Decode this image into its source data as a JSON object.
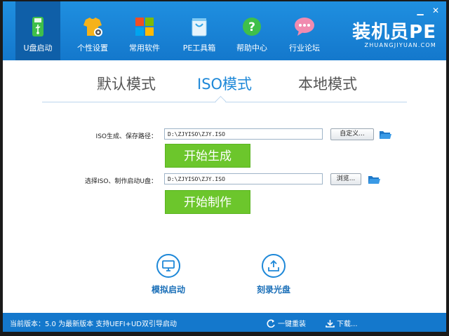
{
  "nav": {
    "items": [
      {
        "label": "U盘启动",
        "icon": "usb-icon"
      },
      {
        "label": "个性设置",
        "icon": "tshirt-gear-icon"
      },
      {
        "label": "常用软件",
        "icon": "windows-tiles-icon"
      },
      {
        "label": "PE工具箱",
        "icon": "shopping-bag-icon"
      },
      {
        "label": "帮助中心",
        "icon": "help-icon"
      },
      {
        "label": "行业论坛",
        "icon": "chat-bubble-icon"
      }
    ],
    "active_index": 0
  },
  "brand": {
    "name": "装机员PE",
    "domain": "ZHUANGJIYUAN.COM"
  },
  "window_controls": {
    "minimize": "▁",
    "close": "✕"
  },
  "tabs": [
    {
      "label": "默认模式"
    },
    {
      "label": "ISO模式"
    },
    {
      "label": "本地模式"
    }
  ],
  "active_tab": 1,
  "iso_row": {
    "label": "ISO生成、保存路径：",
    "path": "D:\\ZJYISO\\ZJY.ISO",
    "browse_label": "自定义...",
    "action_label": "开始生成"
  },
  "usb_row": {
    "label": "选择ISO、制作启动U盘：",
    "path": "D:\\ZJYISO\\ZJY.ISO",
    "browse_label": "浏览...",
    "action_label": "开始制作"
  },
  "actions": {
    "simulate": {
      "label": "模拟启动",
      "icon": "monitor-icon"
    },
    "burn": {
      "label": "刻录光盘",
      "icon": "upload-tray-icon"
    }
  },
  "status": {
    "version_text": "当前版本：5.0 为最新版本 支持UEFI+UD双引导启动",
    "reinstall_label": "一键重装",
    "download_label": "下载..."
  },
  "colors": {
    "primary": "#1478cc",
    "accent": "#1e88d8",
    "green": "#6cc62c"
  }
}
